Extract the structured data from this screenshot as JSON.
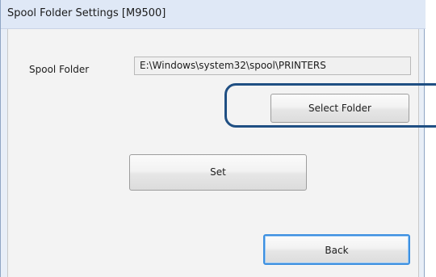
{
  "window": {
    "title": "Spool Folder Settings [M9500]"
  },
  "spool_folder": {
    "label": "Spool Folder",
    "path": "E:\\Windows\\system32\\spool\\PRINTERS"
  },
  "buttons": {
    "select_folder": "Select Folder",
    "set": "Set",
    "back": "Back"
  },
  "colors": {
    "highlight": "#1f4f83",
    "default_button_border": "#3c8fe0"
  }
}
